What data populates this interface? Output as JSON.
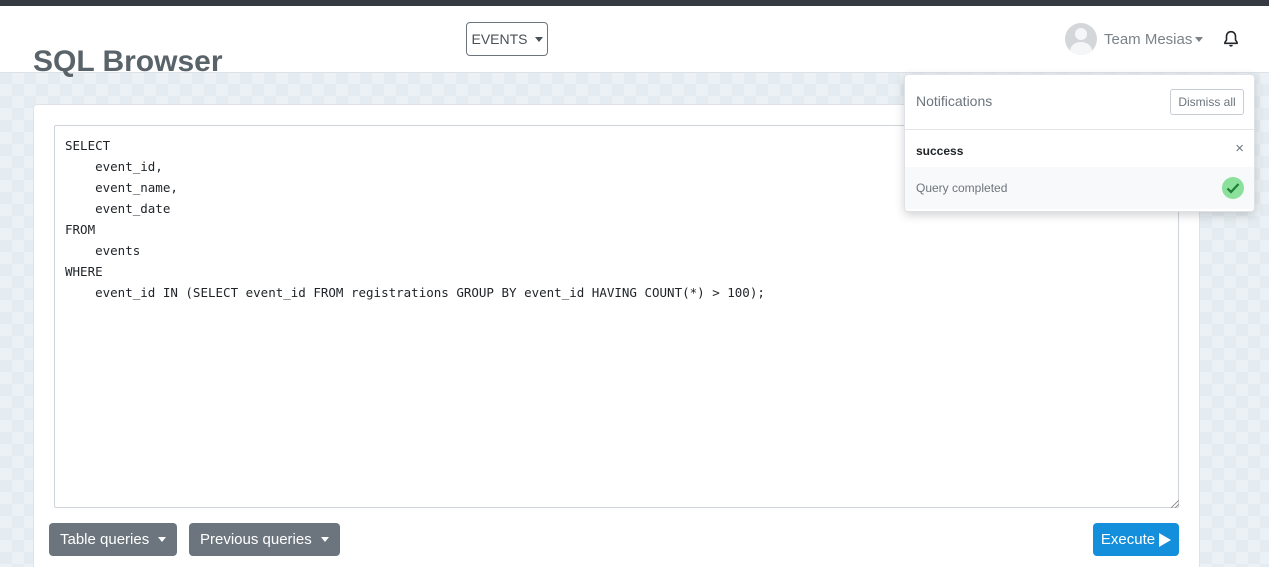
{
  "navbar": {
    "events_label": "EVENTS",
    "user_name": "Team Mesias"
  },
  "page": {
    "title": "SQL Browser"
  },
  "editor": {
    "query": "SELECT\n    event_id,\n    event_name,\n    event_date\nFROM\n    events\nWHERE\n    event_id IN (SELECT event_id FROM registrations GROUP BY event_id HAVING COUNT(*) > 100);"
  },
  "actions": {
    "table_queries": "Table queries",
    "previous_queries": "Previous queries",
    "execute": "Execute"
  },
  "notifications": {
    "title": "Notifications",
    "dismiss_all": "Dismiss all",
    "items": [
      {
        "type": "success",
        "message": "Query completed",
        "close": "×"
      }
    ]
  },
  "colors": {
    "primary": "#138fdc",
    "secondary": "#6c757d",
    "success": "#8be09b"
  }
}
